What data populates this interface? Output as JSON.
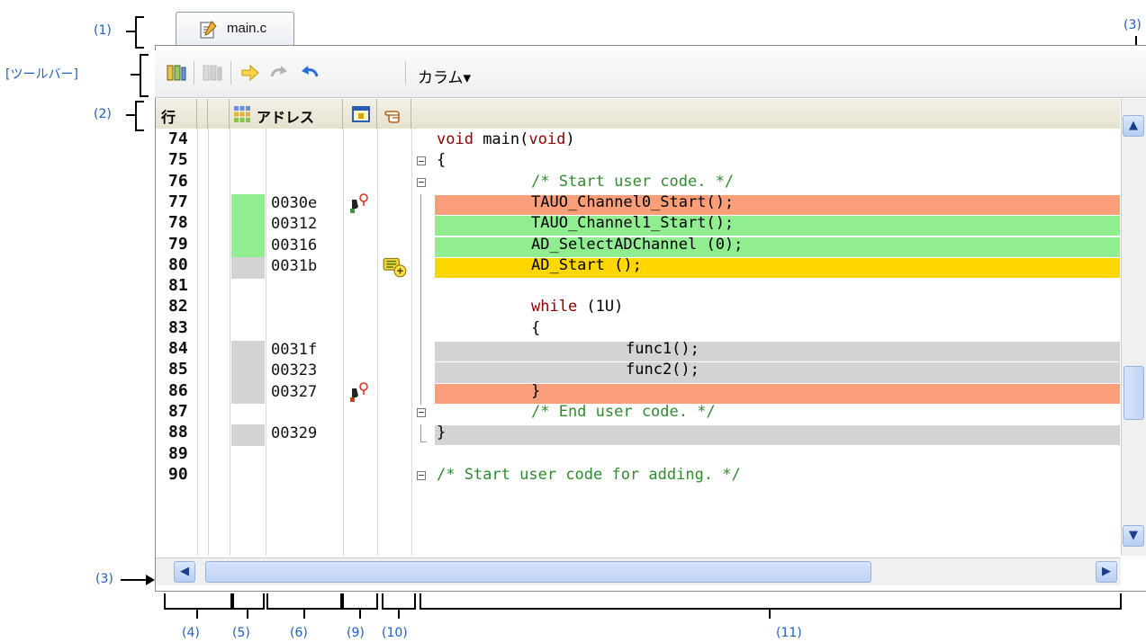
{
  "tab": {
    "label": "main.c",
    "icon": "source-file-icon"
  },
  "annotations": {
    "a1": "(1)",
    "toolbar": "[ツールバー]",
    "a2": "(2)",
    "a3_top": "(3)",
    "a3_left": "(3)",
    "a4": "(4)",
    "a5": "(5)",
    "a6": "(6)",
    "a9": "(9)",
    "a10": "(10)",
    "a11": "(11)"
  },
  "toolbar": {
    "buttons": [
      "go-to-disassemble-icon",
      "go-to-disassemble-disabled-icon",
      "current-pc-arrow-icon",
      "forward-icon",
      "back-icon"
    ],
    "column_label": "カラム▾"
  },
  "header": {
    "line_label": "行",
    "address_label": "アドレス"
  },
  "colors": {
    "breakpoint_hit": "#fb9f7a",
    "coverage_full": "#90ee90",
    "current_pc": "#ffd700",
    "executed": "#d3d3d3",
    "keyword": "#8b0000",
    "comment": "#2e8b2e"
  },
  "rows": [
    {
      "line": "74",
      "addr": "",
      "cov": "",
      "bar": "",
      "code": [
        {
          "t": "void",
          "c": "kw"
        },
        {
          "t": " main(",
          "c": ""
        },
        {
          "t": "void",
          "c": "kw"
        },
        {
          "t": ")",
          "c": ""
        }
      ],
      "fold": "",
      "ind": 0,
      "mark": ""
    },
    {
      "line": "75",
      "addr": "",
      "cov": "",
      "bar": "",
      "code": [
        {
          "t": "{",
          "c": ""
        }
      ],
      "fold": "minus",
      "ind": 0,
      "mark": ""
    },
    {
      "line": "76",
      "addr": "",
      "cov": "",
      "bar": "",
      "code": [
        {
          "t": "/* Start user code. */",
          "c": "cm"
        }
      ],
      "fold": "minus",
      "ind": 1,
      "mark": ""
    },
    {
      "line": "77",
      "addr": "0030e",
      "cov": "green",
      "bar": "salmon",
      "code": [
        {
          "t": "TAUO_Channel0_Start();",
          "c": ""
        }
      ],
      "fold": "",
      "ind": 1,
      "mark": "bp"
    },
    {
      "line": "78",
      "addr": "00312",
      "cov": "green",
      "bar": "green",
      "code": [
        {
          "t": "TAUO_Channel1_Start();",
          "c": ""
        }
      ],
      "fold": "",
      "ind": 1,
      "mark": ""
    },
    {
      "line": "79",
      "addr": "00316",
      "cov": "green",
      "bar": "green",
      "code": [
        {
          "t": "AD_SelectADChannel (0);",
          "c": ""
        }
      ],
      "fold": "",
      "ind": 1,
      "mark": ""
    },
    {
      "line": "80",
      "addr": "0031b",
      "cov": "gray",
      "bar": "gold",
      "code": [
        {
          "t": "AD_Start ();",
          "c": ""
        }
      ],
      "fold": "",
      "ind": 1,
      "mark": "pc"
    },
    {
      "line": "81",
      "addr": "",
      "cov": "",
      "bar": "",
      "code": [],
      "fold": "",
      "ind": 1,
      "mark": ""
    },
    {
      "line": "82",
      "addr": "",
      "cov": "",
      "bar": "",
      "code": [
        {
          "t": "while",
          "c": "kw"
        },
        {
          "t": " (1U)",
          "c": ""
        }
      ],
      "fold": "",
      "ind": 1,
      "mark": ""
    },
    {
      "line": "83",
      "addr": "",
      "cov": "",
      "bar": "",
      "code": [
        {
          "t": "{",
          "c": ""
        }
      ],
      "fold": "",
      "ind": 1,
      "mark": ""
    },
    {
      "line": "84",
      "addr": "0031f",
      "cov": "gray",
      "bar": "gray",
      "code": [
        {
          "t": "func1();",
          "c": ""
        }
      ],
      "fold": "",
      "ind": 2,
      "mark": ""
    },
    {
      "line": "85",
      "addr": "00323",
      "cov": "gray",
      "bar": "gray",
      "code": [
        {
          "t": "func2();",
          "c": ""
        }
      ],
      "fold": "",
      "ind": 2,
      "mark": ""
    },
    {
      "line": "86",
      "addr": "00327",
      "cov": "gray",
      "bar": "salmon",
      "code": [
        {
          "t": "}",
          "c": ""
        }
      ],
      "fold": "",
      "ind": 1,
      "mark": "bp2"
    },
    {
      "line": "87",
      "addr": "",
      "cov": "",
      "bar": "",
      "code": [
        {
          "t": "/* End user code. */",
          "c": "cm"
        }
      ],
      "fold": "minus",
      "ind": 1,
      "mark": ""
    },
    {
      "line": "88",
      "addr": "00329",
      "cov": "gray",
      "bar": "gray",
      "code": [
        {
          "t": "}",
          "c": ""
        }
      ],
      "fold": "end",
      "ind": 0,
      "mark": ""
    },
    {
      "line": "89",
      "addr": "",
      "cov": "",
      "bar": "",
      "code": [],
      "fold": "",
      "ind": 0,
      "mark": ""
    },
    {
      "line": "90",
      "addr": "",
      "cov": "",
      "bar": "",
      "code": [
        {
          "t": "/* Start user code for adding. */",
          "c": "cm"
        }
      ],
      "fold": "minus",
      "ind": 0,
      "mark": ""
    }
  ]
}
